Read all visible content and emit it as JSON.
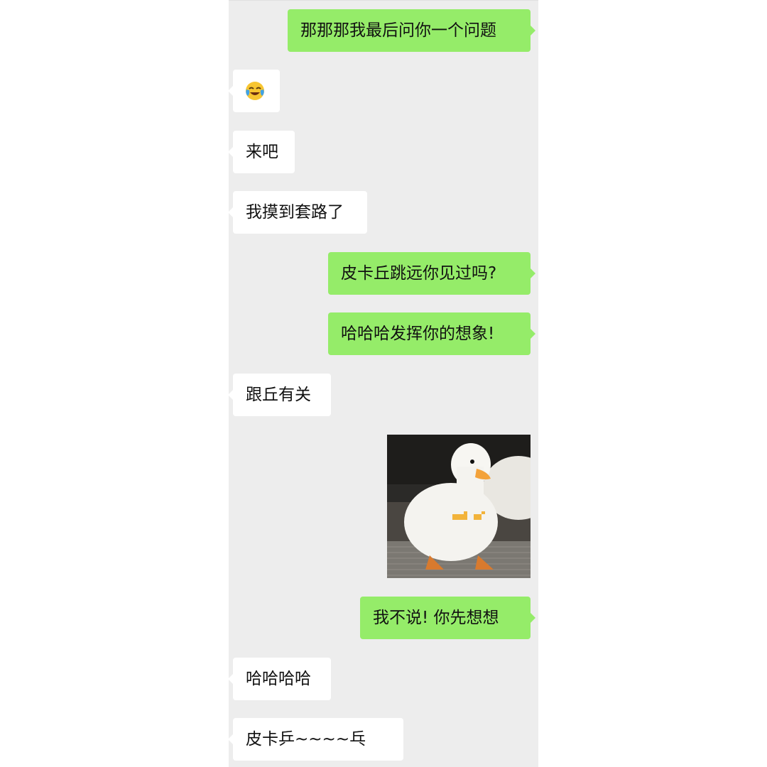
{
  "messages": [
    {
      "side": "out",
      "text": "那那那我最后问你一个问题"
    },
    {
      "side": "in",
      "type": "emoji",
      "icon": "laughing-crying-face-icon"
    },
    {
      "side": "in",
      "text": "来吧"
    },
    {
      "side": "in",
      "text": "我摸到套路了"
    },
    {
      "side": "out",
      "text": "皮卡丘跳远你见过吗?"
    },
    {
      "side": "out",
      "text": "哈哈哈发挥你的想象!"
    },
    {
      "side": "in",
      "text": "跟丘有关"
    },
    {
      "side": "out",
      "type": "sticker",
      "icon": "duck-sticker"
    },
    {
      "side": "out",
      "text": "我不说! 你先想想"
    },
    {
      "side": "in",
      "text": "哈哈哈哈"
    },
    {
      "side": "in",
      "text": "皮卡乒~~~~乓"
    }
  ],
  "colors": {
    "chat_background": "#ededed",
    "outgoing_bubble": "#95ec69",
    "incoming_bubble": "#ffffff"
  }
}
